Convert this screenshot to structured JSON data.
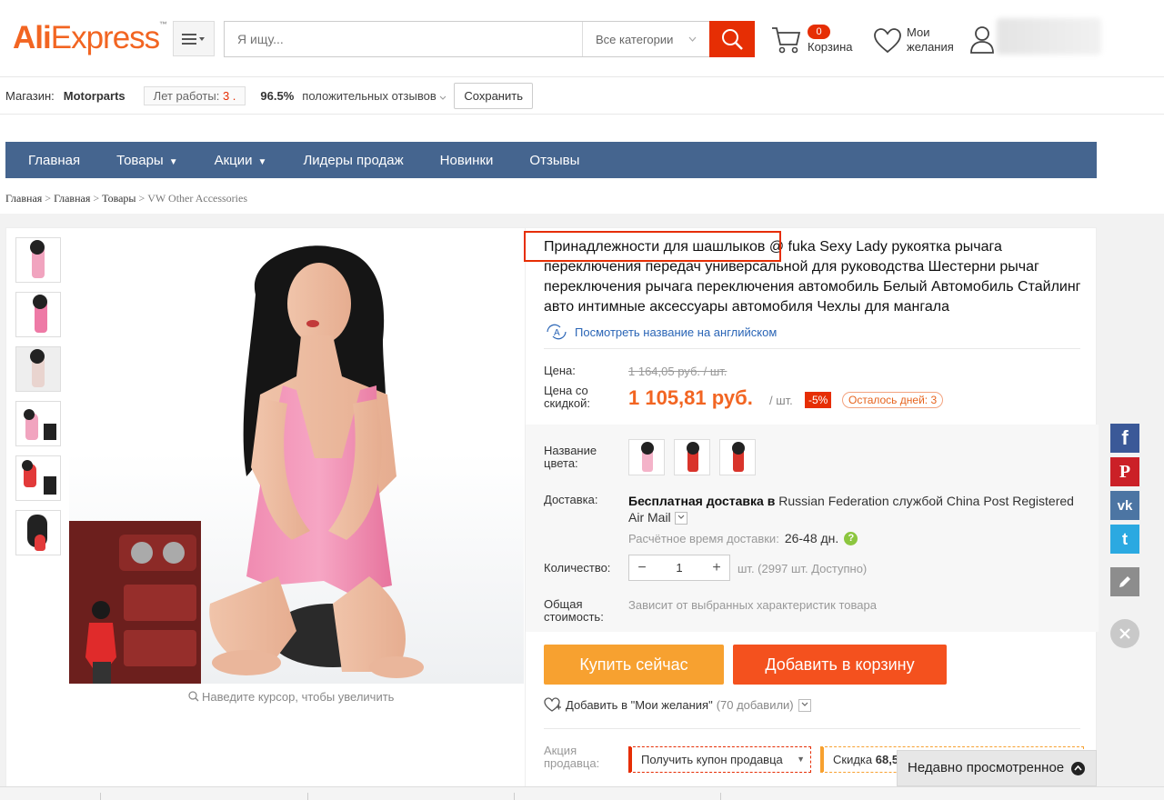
{
  "header": {
    "logo_ali": "Ali",
    "logo_express": "Express",
    "logo_tm": "™",
    "search_placeholder": "Я ищу...",
    "category": "Все категории",
    "cart_count": "0",
    "cart_label": "Корзина",
    "wish_line1": "Мои",
    "wish_line2": "желания"
  },
  "store": {
    "label": "Магазин:",
    "name": "Motorparts",
    "years_label": "Лет работы:",
    "years_value": "3 .",
    "positive_pct": "96.5%",
    "positive_label": "положительных отзывов",
    "save_label": "Сохранить"
  },
  "nav": {
    "items": [
      "Главная",
      "Товары",
      "Акции",
      "Лидеры продаж",
      "Новинки",
      "Отзывы"
    ]
  },
  "breadcrumb": {
    "items": [
      "Главная",
      "Главная",
      "Товары"
    ],
    "sep": ">",
    "current": "VW Other Accessories"
  },
  "gallery": {
    "zoom_hint": "Наведите курсор, чтобы увеличить"
  },
  "product": {
    "title": "Принадлежности для шашлыков @ fuka Sexy Lady рукоятка рычага переключения передач универсальной для руководства Шестерни рычаг переключения рычага переключения автомобиль Белый Автомобиль Стайлинг авто интимные аксессуары автомобиля Чехлы для мангала",
    "translate_link": "Посмотреть название на английском",
    "price_label": "Цена:",
    "old_price": "1 164,05 руб. / шт.",
    "discount_label": "Цена со скидкой:",
    "price": "1 105,81 руб.",
    "per_unit": "/ шт.",
    "discount_pct": "-5%",
    "days_left": "Осталось дней: 3",
    "color_label": "Название цвета:",
    "swatch_colors": [
      "#f4b3c9",
      "#d9342b",
      "#d9342b"
    ],
    "shipping_label": "Доставка:",
    "shipping_bold": "Бесплатная доставка в",
    "shipping_rest": "Russian Federation службой China Post Registered Air Mail",
    "eta_label": "Расчётное время доставки:",
    "eta_value": "26-48 дн.",
    "eta_help": "?",
    "qty_label": "Количество:",
    "qty_minus": "−",
    "qty_value": "1",
    "qty_plus": "+",
    "availability": "шт. (2997 шт. Доступно)",
    "total_label": "Общая стоимость:",
    "total_value": "Зависит от выбранных характеристик товара",
    "buy_now": "Купить сейчас",
    "add_to_cart": "Добавить в корзину",
    "wish_add": "Добавить в \"Мои желания\"",
    "wish_count": "(70 добавили)",
    "promo_label": "Акция продавца:",
    "coupon_label": "Получить купон продавца",
    "discount_offer_prefix": "Скидка",
    "discount_offer_value": "68,5"
  },
  "social": {
    "facebook": "f",
    "pinterest": "P",
    "vk": "vk",
    "twitter": "t"
  },
  "recent": {
    "label": "Недавно просмотренное"
  },
  "colors": {
    "brand": "#f26522",
    "nav_bg": "#45658f",
    "buy_now": "#f7a130",
    "add_cart": "#f4511e",
    "search_btn": "#e62e04"
  }
}
